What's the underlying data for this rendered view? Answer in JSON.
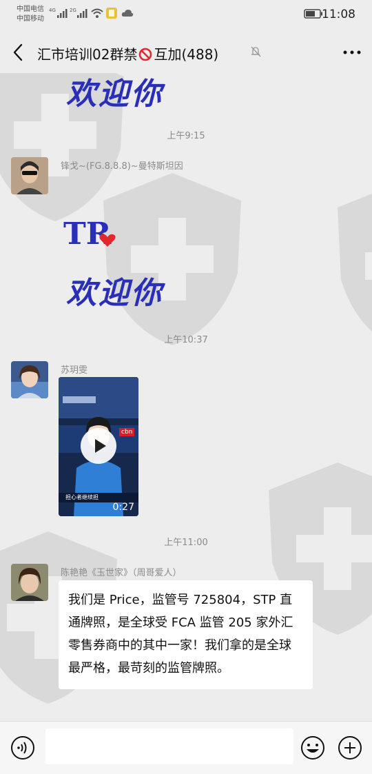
{
  "status_bar": {
    "carrier_1": "中国电信",
    "carrier_2": "中国移动",
    "signal_1": "4G",
    "signal_2": "2G",
    "time": "11:08"
  },
  "nav": {
    "title_part1": "汇市培训02群禁",
    "title_part2": "互加(488)"
  },
  "messages": {
    "sticker_1_text": "欢迎你",
    "sep_1": "上午9:15",
    "sender_1": "锋戈~(FG.8.8.8)~曼特斯坦因",
    "sticker_2_tr": "TR",
    "sticker_2_text": "欢迎你",
    "sep_2": "上午10:37",
    "sender_2": "苏玥雯",
    "video_duration": "0:27",
    "video_logo": "cbn",
    "video_caption": "担心者继续担",
    "sep_3": "上午11:00",
    "sender_3": "陈艳艳《玉世家》（周哥爱人）",
    "text_3": "我们是 Price，监管号 725804，STP 直通牌照，是全球受 FCA 监管 205 家外汇零售券商中的其中一家！我们拿的是全球最严格，最苛刻的监管牌照。"
  },
  "input_bar": {
    "placeholder": ""
  },
  "colors": {
    "background": "#ededed",
    "sticker_blue": "#2a2fb8",
    "ban_red": "#e0282d"
  }
}
